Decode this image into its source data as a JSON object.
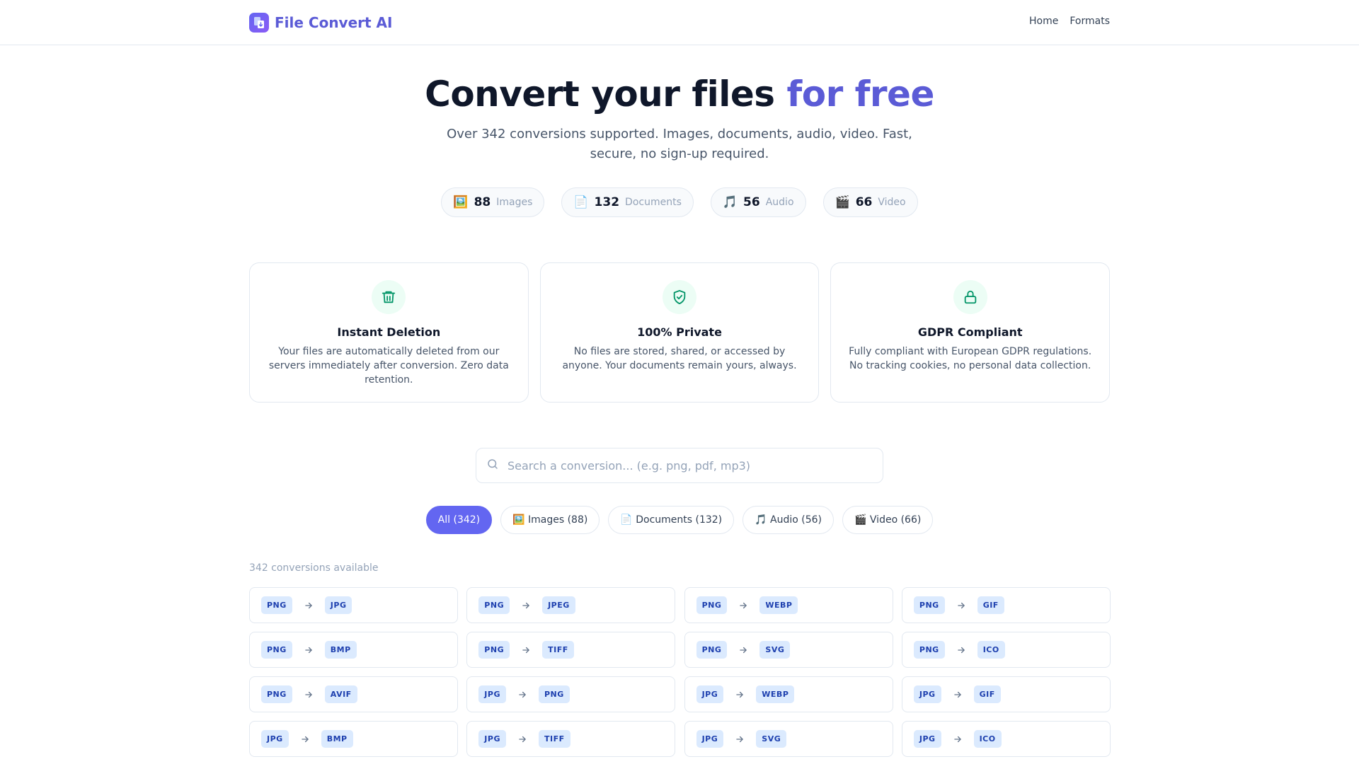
{
  "header": {
    "brand": "File Convert AI",
    "nav": [
      "Home",
      "Formats"
    ]
  },
  "hero": {
    "title_main": "Convert your files",
    "title_accent": "for free",
    "subtitle": "Over 342 conversions supported. Images, documents, audio, video. Fast, secure, no sign-up required."
  },
  "stats": [
    {
      "icon": "🖼️",
      "value": "88",
      "label": "Images"
    },
    {
      "icon": "📄",
      "value": "132",
      "label": "Documents"
    },
    {
      "icon": "🎵",
      "value": "56",
      "label": "Audio"
    },
    {
      "icon": "🎬",
      "value": "66",
      "label": "Video"
    }
  ],
  "features": [
    {
      "icon": "trash-icon",
      "title": "Instant Deletion",
      "text": "Your files are automatically deleted from our servers immediately after conversion. Zero data retention."
    },
    {
      "icon": "shield-check-icon",
      "title": "100% Private",
      "text": "No files are stored, shared, or accessed by anyone. Your documents remain yours, always."
    },
    {
      "icon": "lock-icon",
      "title": "GDPR Compliant",
      "text": "Fully compliant with European GDPR regulations. No tracking cookies, no personal data collection."
    }
  ],
  "search": {
    "placeholder": "Search a conversion... (e.g. png, pdf, mp3)"
  },
  "filters": [
    "All (342)",
    "🖼️ Images (88)",
    "📄 Documents (132)",
    "🎵 Audio (56)",
    "🎬 Video (66)"
  ],
  "results_count": "342 conversions available",
  "conversions": [
    {
      "from": "PNG",
      "to": "JPG"
    },
    {
      "from": "PNG",
      "to": "JPEG"
    },
    {
      "from": "PNG",
      "to": "WEBP"
    },
    {
      "from": "PNG",
      "to": "GIF"
    },
    {
      "from": "PNG",
      "to": "BMP"
    },
    {
      "from": "PNG",
      "to": "TIFF"
    },
    {
      "from": "PNG",
      "to": "SVG"
    },
    {
      "from": "PNG",
      "to": "ICO"
    },
    {
      "from": "PNG",
      "to": "AVIF"
    },
    {
      "from": "JPG",
      "to": "PNG"
    },
    {
      "from": "JPG",
      "to": "WEBP"
    },
    {
      "from": "JPG",
      "to": "GIF"
    },
    {
      "from": "JPG",
      "to": "BMP"
    },
    {
      "from": "JPG",
      "to": "TIFF"
    },
    {
      "from": "JPG",
      "to": "SVG"
    },
    {
      "from": "JPG",
      "to": "ICO"
    }
  ],
  "colors": {
    "accent": "#6366f1",
    "brand_text": "#5b5bd6",
    "feature_icon": "#059669",
    "pill_bg": "#dbeafe",
    "pill_text": "#1e40af"
  }
}
